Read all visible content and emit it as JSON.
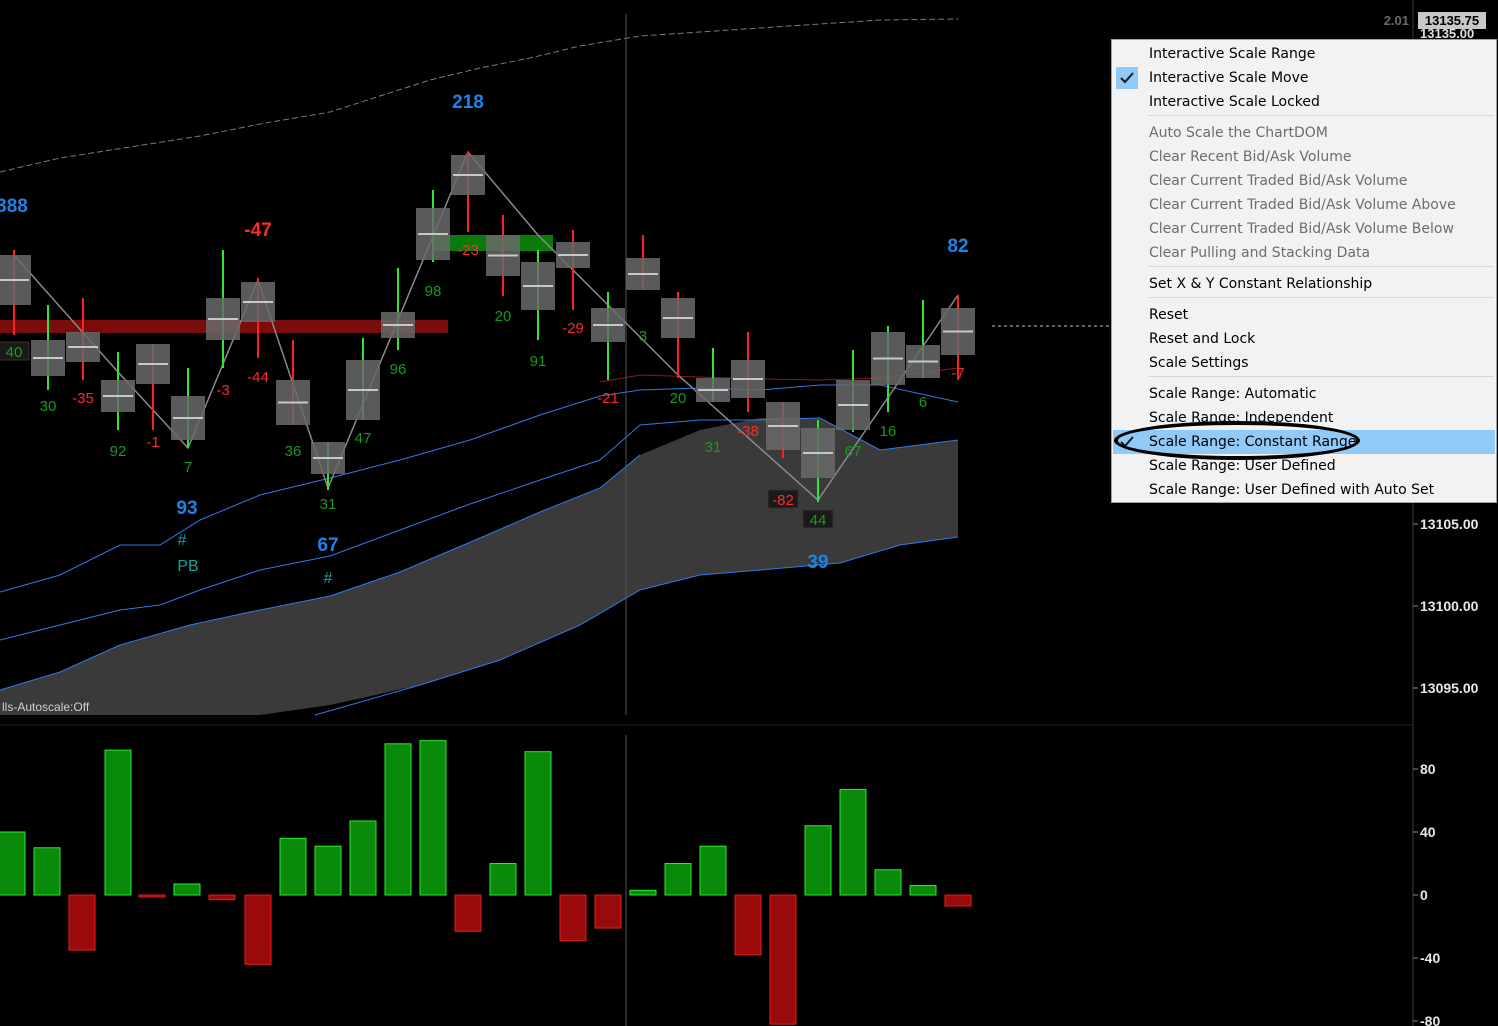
{
  "colors": {
    "background": "#000000",
    "up_label": "#1a9a1a",
    "down_label": "#ff2a2a",
    "blue_label": "#1e82e6",
    "band_line": "#2e7be8",
    "volume_up": "#0a8a0a",
    "volume_down": "#9a0a0a",
    "menu_highlight": "#91c9f7"
  },
  "price_axis": {
    "top_readout_small": "2.01",
    "top_readout": "13135.75",
    "top_label": "13135.00",
    "ticks": [
      {
        "value": 13105,
        "label": "13105.00"
      },
      {
        "value": 13100,
        "label": "13100.00"
      },
      {
        "value": 13095,
        "label": "13095.00"
      }
    ]
  },
  "volume_axis": {
    "ticks": [
      {
        "value": 80,
        "label": "80"
      },
      {
        "value": 40,
        "label": "40"
      },
      {
        "value": 0,
        "label": "0"
      },
      {
        "value": -40,
        "label": "-40"
      },
      {
        "value": -80,
        "label": "-80"
      }
    ]
  },
  "status_text": "lls-Autoscale:Off",
  "chart_data": {
    "type": "bar",
    "delta_labels": [
      {
        "text": "40",
        "color": "up",
        "boxed": true
      },
      {
        "text": "30",
        "color": "up"
      },
      {
        "text": "-35",
        "color": "down"
      },
      {
        "text": "92",
        "color": "up"
      },
      {
        "text": "-1",
        "color": "down"
      },
      {
        "text": "7",
        "color": "up"
      },
      {
        "text": "-3",
        "color": "down"
      },
      {
        "text": "-44",
        "color": "down"
      },
      {
        "text": "36",
        "color": "up"
      },
      {
        "text": "31",
        "color": "up"
      },
      {
        "text": "47",
        "color": "up"
      },
      {
        "text": "96",
        "color": "up"
      },
      {
        "text": "98",
        "color": "up"
      },
      {
        "text": "-23",
        "color": "down"
      },
      {
        "text": "20",
        "color": "up"
      },
      {
        "text": "91",
        "color": "up"
      },
      {
        "text": "-29",
        "color": "down"
      },
      {
        "text": "-21",
        "color": "down"
      },
      {
        "text": "3",
        "color": "up"
      },
      {
        "text": "20",
        "color": "up"
      },
      {
        "text": "31",
        "color": "up"
      },
      {
        "text": "-38",
        "color": "down"
      },
      {
        "text": "-82",
        "color": "down",
        "boxed": true
      },
      {
        "text": "44",
        "color": "up",
        "boxed": true
      },
      {
        "text": "67",
        "color": "up"
      },
      {
        "text": "16",
        "color": "up"
      },
      {
        "text": "6",
        "color": "up"
      },
      {
        "text": "-7",
        "color": "down"
      }
    ],
    "swing_labels": [
      {
        "text": "388",
        "color": "blue"
      },
      {
        "text": "-47",
        "color": "down"
      },
      {
        "text": "218",
        "color": "blue"
      },
      {
        "text": "82",
        "color": "blue"
      },
      {
        "text": "93",
        "color": "blue"
      },
      {
        "text": "67",
        "color": "blue"
      },
      {
        "text": "39",
        "color": "blue"
      }
    ],
    "markers": [
      {
        "text": "#"
      },
      {
        "text": "PB"
      },
      {
        "text": "#"
      }
    ],
    "volume_delta": [
      40,
      30,
      -35,
      92,
      -1,
      7,
      -3,
      -44,
      36,
      31,
      47,
      96,
      98,
      -23,
      20,
      91,
      -29,
      -21,
      3,
      20,
      31,
      -38,
      -82,
      44,
      67,
      16,
      6,
      -7
    ]
  },
  "menu": {
    "items": [
      {
        "label": "Interactive Scale Range",
        "checked": false,
        "disabled": false
      },
      {
        "label": "Interactive Scale Move",
        "checked": true,
        "disabled": false
      },
      {
        "label": "Interactive Scale Locked",
        "checked": false,
        "disabled": false
      },
      {
        "label": "Auto Scale the ChartDOM",
        "checked": false,
        "disabled": true
      },
      {
        "label": "Clear Recent Bid/Ask Volume",
        "checked": false,
        "disabled": true
      },
      {
        "label": "Clear Current Traded Bid/Ask Volume",
        "checked": false,
        "disabled": true
      },
      {
        "label": "Clear Current Traded Bid/Ask Volume Above",
        "checked": false,
        "disabled": true
      },
      {
        "label": "Clear Current Traded Bid/Ask Volume Below",
        "checked": false,
        "disabled": true
      },
      {
        "label": "Clear Pulling and Stacking Data",
        "checked": false,
        "disabled": true
      },
      {
        "label": "Set X & Y Constant Relationship",
        "checked": false,
        "disabled": false
      },
      {
        "label": "Reset",
        "checked": false,
        "disabled": false
      },
      {
        "label": "Reset and Lock",
        "checked": false,
        "disabled": false
      },
      {
        "label": "Scale Settings",
        "checked": false,
        "disabled": false
      },
      {
        "label": "Scale Range: Automatic",
        "checked": false,
        "disabled": false
      },
      {
        "label": "Scale Range: Independent",
        "checked": false,
        "disabled": false
      },
      {
        "label": "Scale Range: Constant Range",
        "checked": true,
        "disabled": false,
        "highlighted": true
      },
      {
        "label": "Scale Range: User Defined",
        "checked": false,
        "disabled": false
      },
      {
        "label": "Scale Range: User Defined with Auto Set",
        "checked": false,
        "disabled": false
      }
    ]
  }
}
